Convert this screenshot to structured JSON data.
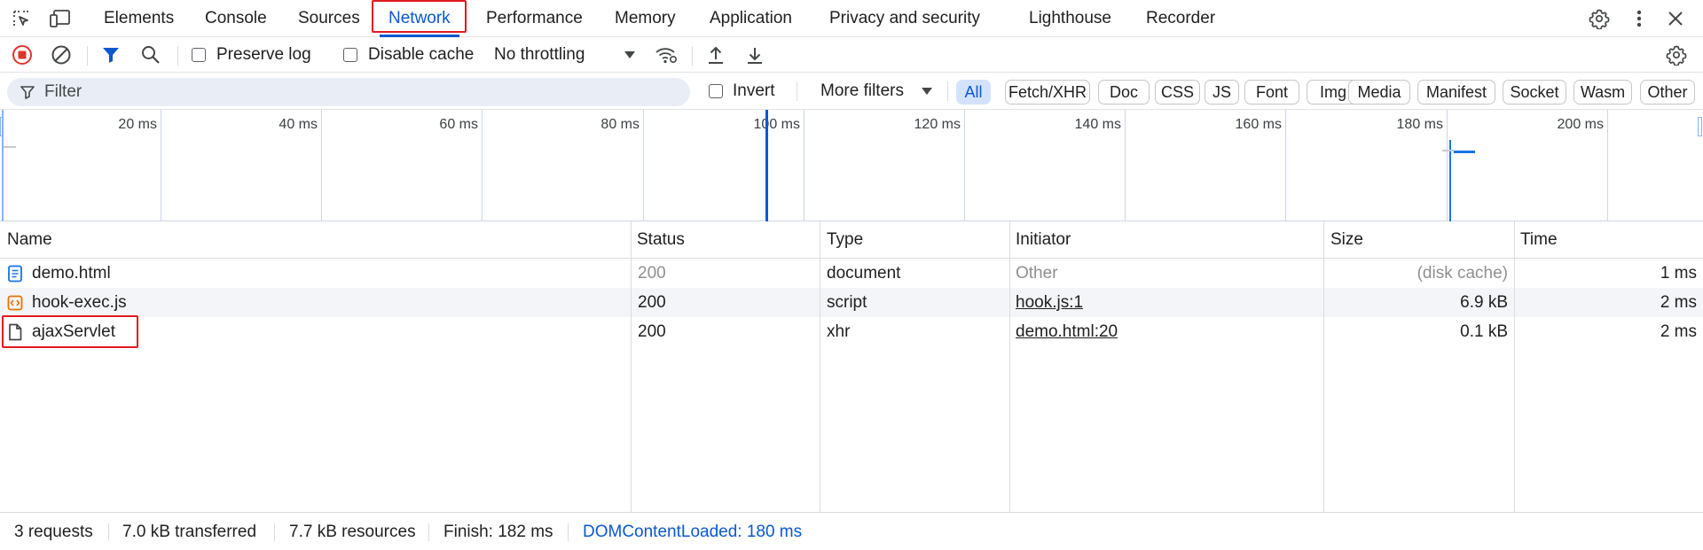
{
  "tabs": [
    {
      "label": "Elements"
    },
    {
      "label": "Console"
    },
    {
      "label": "Sources"
    },
    {
      "label": "Network"
    },
    {
      "label": "Performance"
    },
    {
      "label": "Memory"
    },
    {
      "label": "Application"
    },
    {
      "label": "Privacy and security"
    },
    {
      "label": "Lighthouse"
    },
    {
      "label": "Recorder"
    }
  ],
  "active_tab": "Network",
  "toolbar": {
    "preserve_log": "Preserve log",
    "disable_cache": "Disable cache",
    "throttling": "No throttling"
  },
  "filter": {
    "placeholder": "Filter",
    "invert": "Invert",
    "more_filters": "More filters",
    "chips": [
      "All",
      "Fetch/XHR",
      "Doc",
      "CSS",
      "JS",
      "Font",
      "Img",
      "Media",
      "Manifest",
      "Socket",
      "Wasm",
      "Other"
    ],
    "selected_chip": "All"
  },
  "overview": {
    "ticks": [
      "20 ms",
      "40 ms",
      "60 ms",
      "80 ms",
      "100 ms",
      "120 ms",
      "140 ms",
      "160 ms",
      "180 ms",
      "200 ms"
    ]
  },
  "columns": {
    "name": "Name",
    "status": "Status",
    "type": "Type",
    "initiator": "Initiator",
    "size": "Size",
    "time": "Time"
  },
  "requests": [
    {
      "name": "demo.html",
      "status": "200",
      "type": "document",
      "initiator": "Other",
      "size": "(disk cache)",
      "time": "1 ms",
      "icon": "document-icon"
    },
    {
      "name": "hook-exec.js",
      "status": "200",
      "type": "script",
      "initiator": "hook.js:1",
      "size": "6.9 kB",
      "time": "2 ms",
      "icon": "script-icon"
    },
    {
      "name": "ajaxServlet",
      "status": "200",
      "type": "xhr",
      "initiator": "demo.html:20",
      "size": "0.1 kB",
      "time": "2 ms",
      "icon": "file-icon"
    }
  ],
  "status_bar": {
    "requests": "3 requests",
    "transferred": "7.0 kB transferred",
    "resources": "7.7 kB resources",
    "finish": "Finish: 182 ms",
    "dom_content_loaded": "DOMContentLoaded: 180 ms"
  },
  "colors": {
    "accent": "#0b57d0",
    "highlight_box": "#e3191e",
    "record_red": "#dc362e",
    "dcl_blue": "#0b57d0"
  }
}
